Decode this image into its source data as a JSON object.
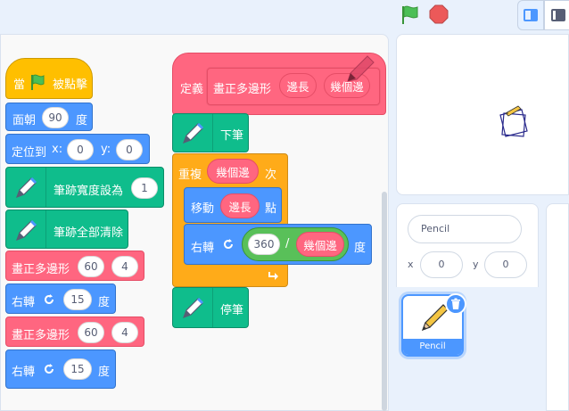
{
  "topbar": {
    "green_flag_icon": "green-flag-icon",
    "stop_icon": "stop-sign-icon"
  },
  "script1": {
    "when_flag": {
      "prefix": "當",
      "suffix": "被點擊"
    },
    "point_dir": {
      "label": "面朝",
      "value": "90",
      "unit": "度"
    },
    "goto_xy": {
      "label": "定位到",
      "x_label": "x:",
      "x_value": "0",
      "y_label": "y:",
      "y_value": "0"
    },
    "pen_size": {
      "label": "筆跡寬度設為",
      "value": "1"
    },
    "pen_clear": {
      "label": "筆跡全部清除"
    },
    "polygon1": {
      "label": "畫正多邊形",
      "arg1": "60",
      "arg2": "4"
    },
    "turn1": {
      "label": "右轉",
      "value": "15",
      "unit": "度"
    },
    "polygon2": {
      "label": "畫正多邊形",
      "arg1": "60",
      "arg2": "4"
    },
    "turn2": {
      "label": "右轉",
      "value": "15",
      "unit": "度"
    }
  },
  "script2": {
    "define": {
      "label": "定義",
      "name": "畫正多邊形",
      "param1": "邊長",
      "param2": "幾個邊"
    },
    "pen_down": {
      "label": "下筆"
    },
    "repeat": {
      "label": "重複",
      "times": "幾個邊",
      "suffix": "次"
    },
    "move": {
      "label": "移動",
      "steps": "邊長",
      "suffix": "點"
    },
    "turn": {
      "label": "右轉",
      "numerator": "360",
      "divide": "/",
      "denominator": "幾個邊",
      "unit": "度"
    },
    "pen_up": {
      "label": "停筆"
    }
  },
  "sprite": {
    "name": "Pencil",
    "x_label": "x",
    "x_value": "0",
    "y_label": "y",
    "y_value": "0",
    "thumb_label": "Pencil"
  },
  "colors": {
    "events": "#ffbf00",
    "motion": "#4c97ff",
    "pen": "#0fbd8c",
    "my_blocks": "#ff6680",
    "control": "#ffab19",
    "operators": "#59c059"
  }
}
